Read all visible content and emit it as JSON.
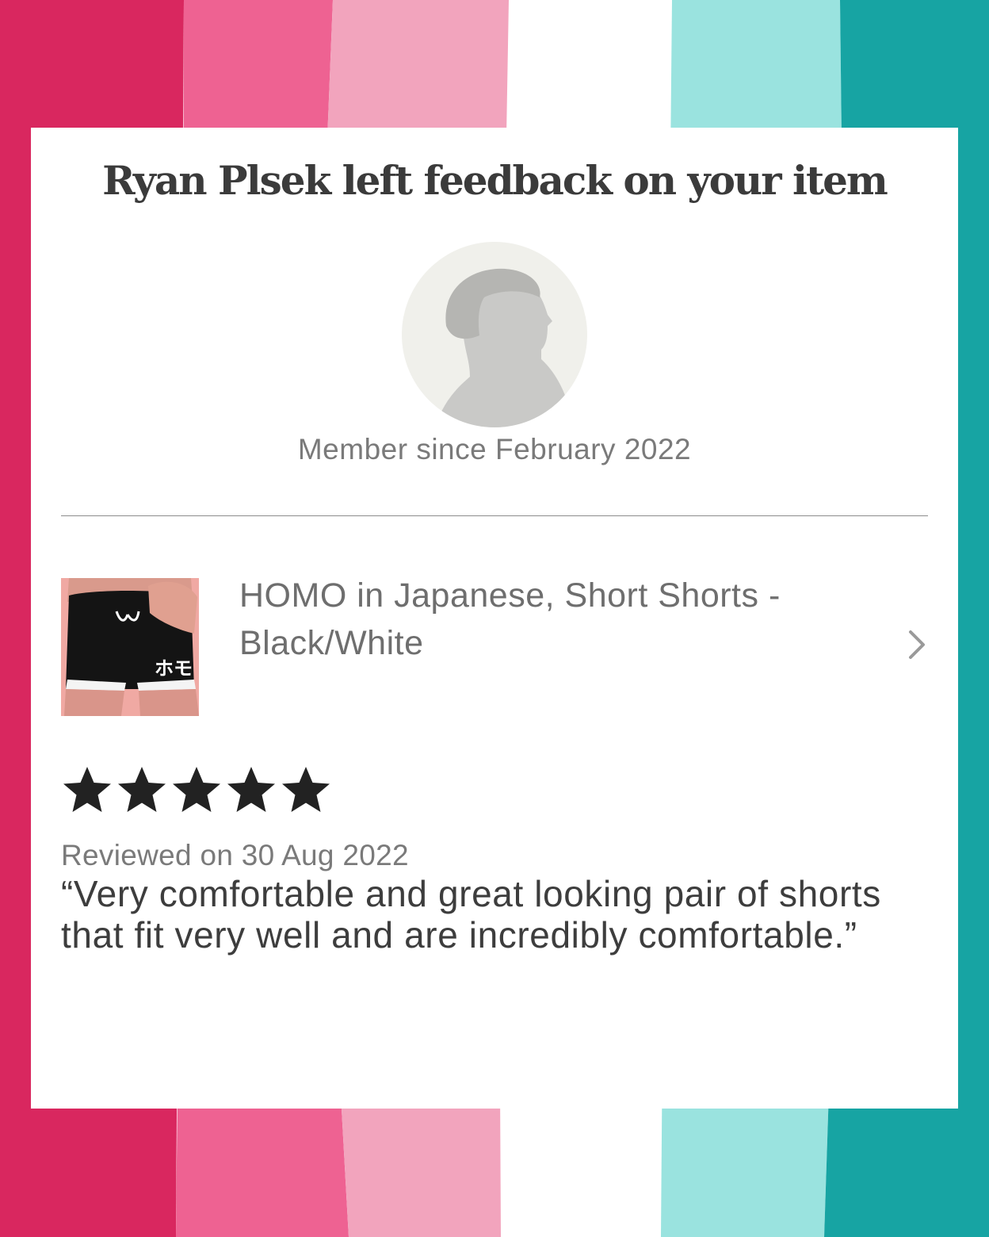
{
  "colors": {
    "stripe_magenta": "#d9275f",
    "stripe_pink": "#ee6292",
    "stripe_light_pink": "#f2a4bd",
    "stripe_white": "#ffffff",
    "stripe_light_teal": "#9ae3df",
    "stripe_teal": "#17a4a3",
    "title_text": "#3b3b3b",
    "muted_text": "#7a7a7a",
    "star": "#222222"
  },
  "notification": {
    "title": "Ryan Plsek left feedback on your item",
    "member_since": "Member since February 2022"
  },
  "avatar": {
    "icon": "default-user-silhouette"
  },
  "item": {
    "title": "HOMO in Japanese, Short Shorts - Black/White",
    "thumbnail_print": "ホモ",
    "chevron_icon": "chevron-right-icon"
  },
  "review": {
    "rating": 5,
    "max_rating": 5,
    "reviewed_on": "Reviewed on 30 Aug 2022",
    "text": "“Very comfortable and great looking pair of shorts that fit very well and are incredibly comfortable.”"
  }
}
